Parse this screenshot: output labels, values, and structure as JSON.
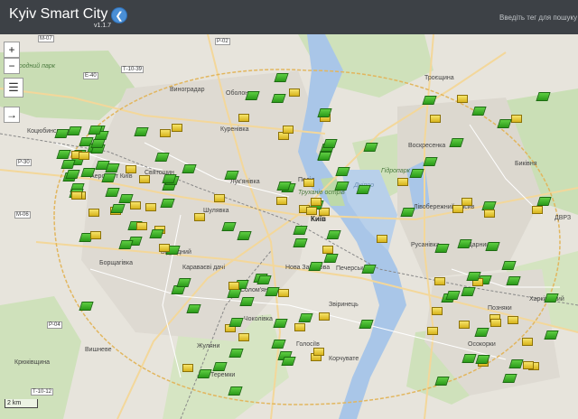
{
  "header": {
    "title": "Kyiv Smart City",
    "version": "v1.1.7",
    "collapse_icon": "chevron-left-icon",
    "search_placeholder": "Введіть тег для пошуку"
  },
  "map_controls": {
    "zoom_in": "+",
    "zoom_out": "−",
    "layers_icon": "layers-icon",
    "export_icon": "→",
    "scale": "2 km"
  },
  "labels": {
    "kyiv": "Київ",
    "podil": "Поділ",
    "obolon": "Оболонь",
    "troieshchyna": "Троєщина",
    "vynohradar": "Виноградар",
    "kurenivka": "Куренівка",
    "lukianivka": "Лук'янівка",
    "shuliavka": "Шулявка",
    "sviatoshyn": "Святошин",
    "vidradnyi": "Відрадний",
    "karavaievi": "Караваєві дачі",
    "solomianka": "Солом'янка",
    "nova_zabudova": "Нова Забудова",
    "pecherськ": "Печерськ",
    "zvirynets": "Звіринець",
    "rusanivka": "Русанівка",
    "livoberezhna": "Лівобережний масив",
    "darnytsia": "Дарниця",
    "voskresenka": "Воскресенка",
    "bykivnia": "Биківня",
    "kotsiubynske": "Коцюбинське",
    "zhuliany": "Жуляни",
    "holosiiv": "Голосіїв",
    "koncha": "Корчувате",
    "vyshneve": "Вишневе",
    "chokolivka": "Чоколівка",
    "teremky": "Теремки",
    "osokorky": "Осокорки",
    "pozniaky": "Позняки",
    "kharkivskyi": "Харківський",
    "kryukivshchyna": "Крюківщина",
    "borshchahivka": "Борщагівка",
    "dvrz": "ДВРЗ",
    "nature_park": "Природний парк",
    "dnipro": "Дніпро",
    "trukhaniv": "Труханів острів",
    "hydropark": "Гідропарк",
    "airport": "Аеропорт Київ"
  },
  "road_labels": [
    "М-07",
    "Р-02",
    "Т-10-39",
    "Р-30",
    "М-06",
    "Р-04",
    "Т-10-12",
    "Е-40"
  ]
}
